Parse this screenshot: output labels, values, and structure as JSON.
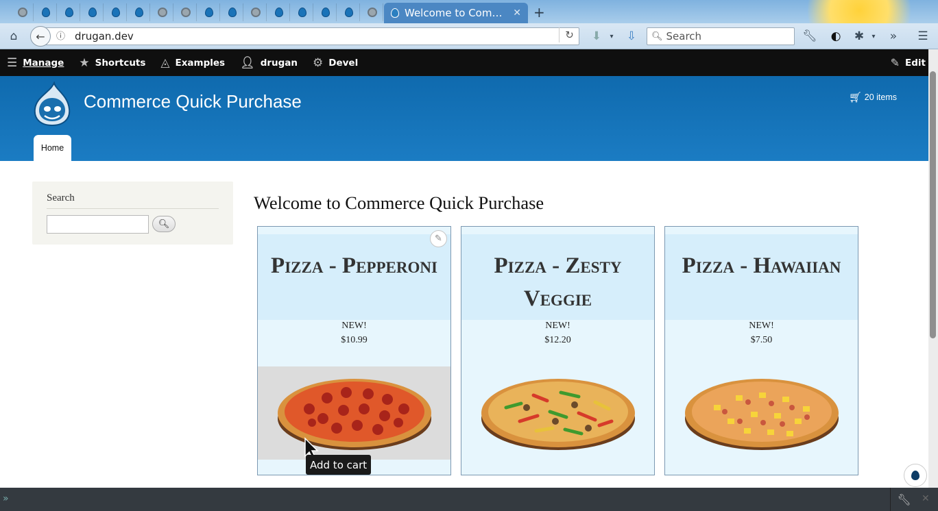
{
  "browser": {
    "active_tab_title": "Welcome to Com…",
    "url": "drugan.dev",
    "search_placeholder": "Search"
  },
  "toolbar": {
    "manage": "Manage",
    "shortcuts": "Shortcuts",
    "examples": "Examples",
    "user": "drugan",
    "devel": "Devel",
    "edit": "Edit"
  },
  "site": {
    "name": "Commerce Quick Purchase",
    "cart": "20 items",
    "nav_home": "Home"
  },
  "sidebar": {
    "title": "Search",
    "input_value": ""
  },
  "main": {
    "title": "Welcome to Commerce Quick Purchase",
    "products": [
      {
        "title": "Pizza - Pepperoni",
        "badge": "NEW!",
        "price": "$10.99",
        "topping": "pepperoni"
      },
      {
        "title": "Pizza - Zesty Veggie",
        "badge": "NEW!",
        "price": "$12.20",
        "topping": "veggie"
      },
      {
        "title": "Pizza - Hawaiian",
        "badge": "NEW!",
        "price": "$7.50",
        "topping": "hawaiian"
      }
    ]
  },
  "tooltip": "Add to cart",
  "colors": {
    "header": "#1b7cc3",
    "toolbar": "#0f0f0f",
    "card_bg": "#e7f6fd",
    "card_head": "#d6eefb"
  }
}
